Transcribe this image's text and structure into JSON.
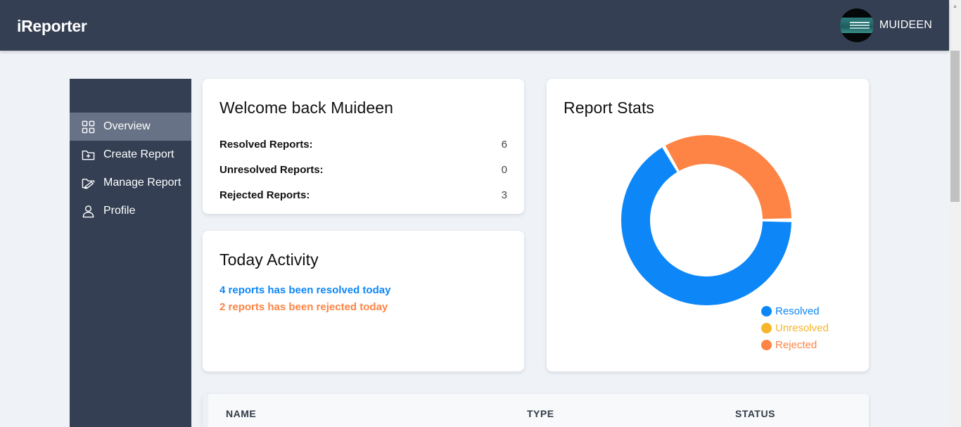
{
  "app": {
    "title": "iReporter"
  },
  "user": {
    "name": "MUIDEEN"
  },
  "sidebar": {
    "items": [
      {
        "label": "Overview",
        "icon": "grid-icon",
        "active": true
      },
      {
        "label": "Create Report",
        "icon": "folder-plus-icon",
        "active": false
      },
      {
        "label": "Manage Report",
        "icon": "folder-edit-icon",
        "active": false
      },
      {
        "label": "Profile",
        "icon": "user-icon",
        "active": false
      }
    ]
  },
  "welcome": {
    "title": "Welcome back Muideen",
    "rows": [
      {
        "label": "Resolved Reports:",
        "value": "6"
      },
      {
        "label": "Unresolved Reports:",
        "value": "0"
      },
      {
        "label": "Rejected Reports:",
        "value": "3"
      }
    ]
  },
  "activity": {
    "title": "Today Activity",
    "resolved_text": "4 reports has been resolved today",
    "rejected_text": "2 reports has been rejected today"
  },
  "stats": {
    "title": "Report Stats",
    "legend": [
      {
        "label": "Resolved",
        "color": "#0d87f7"
      },
      {
        "label": "Unresolved",
        "color": "#f6b52a"
      },
      {
        "label": "Rejected",
        "color": "#fd8444"
      }
    ]
  },
  "chart_data": {
    "type": "pie",
    "categories": [
      "Resolved",
      "Unresolved",
      "Rejected"
    ],
    "values": [
      6,
      0,
      3
    ],
    "colors": [
      "#0d87f7",
      "#f6b52a",
      "#fd8444"
    ],
    "title": "Report Stats",
    "legend_position": "bottom-right",
    "donut": true
  },
  "table": {
    "columns": [
      "NAME",
      "TYPE",
      "STATUS"
    ]
  },
  "colors": {
    "topbar": "#343f53",
    "sidebar": "#343f53",
    "sidebar_active": "#677286",
    "resolved": "#0d87f7",
    "rejected": "#fd8444"
  }
}
